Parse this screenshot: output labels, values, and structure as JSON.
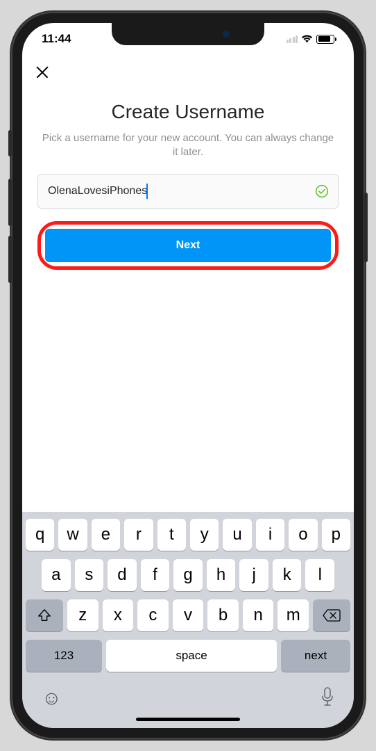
{
  "status": {
    "time": "11:44"
  },
  "header": {
    "title": "Create Username",
    "subtitle": "Pick a username for your new account. You can always change it later."
  },
  "form": {
    "username_value": "OlenaLovesiPhones",
    "next_label": "Next"
  },
  "keyboard": {
    "row1": [
      "q",
      "w",
      "e",
      "r",
      "t",
      "y",
      "u",
      "i",
      "o",
      "p"
    ],
    "row2": [
      "a",
      "s",
      "d",
      "f",
      "g",
      "h",
      "j",
      "k",
      "l"
    ],
    "row3": [
      "z",
      "x",
      "c",
      "v",
      "b",
      "n",
      "m"
    ],
    "mode_label": "123",
    "space_label": "space",
    "return_label": "next"
  },
  "icons": {
    "close": "close-icon",
    "check": "checkmark-circle-icon",
    "shift": "shift-icon",
    "backspace": "backspace-icon",
    "emoji": "emoji-icon",
    "mic": "mic-icon"
  }
}
